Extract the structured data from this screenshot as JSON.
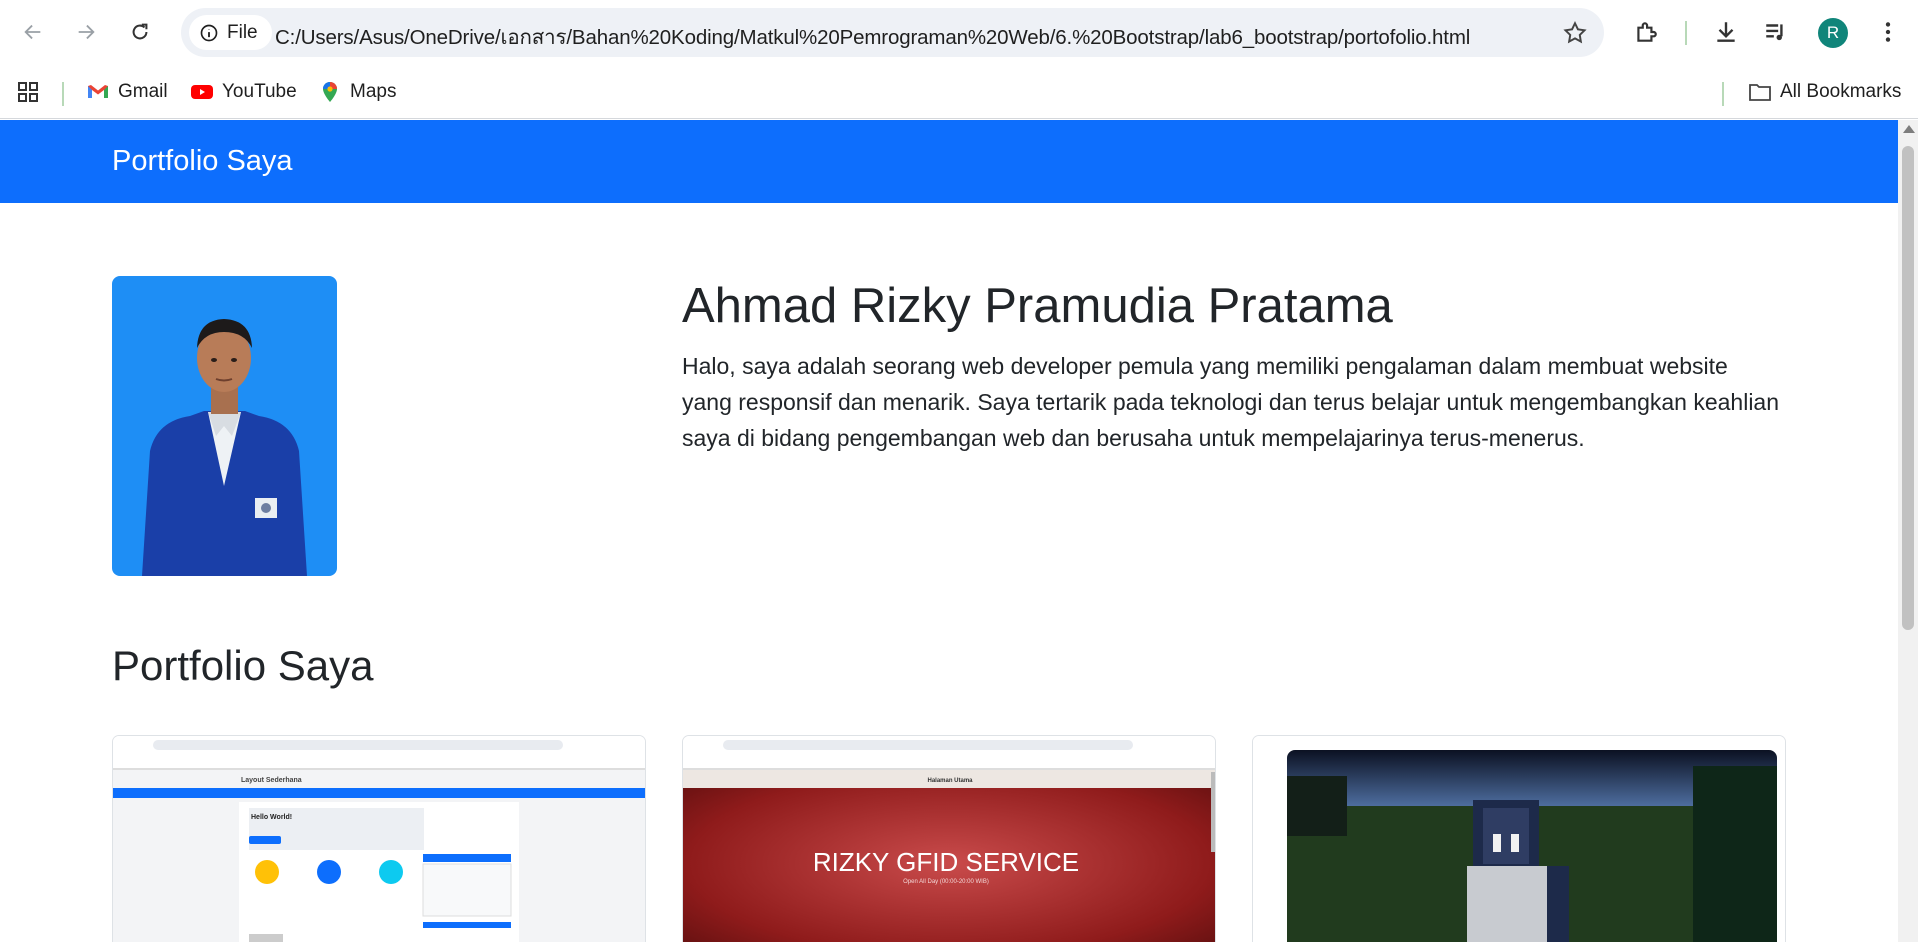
{
  "browser": {
    "chip_label": "File",
    "url": "C:/Users/Asus/OneDrive/เอกสาร/Bahan%20Koding/Matkul%20Pemrograman%20Web/6.%20Bootstrap/lab6_bootstrap/portofolio.html",
    "avatar_letter": "R",
    "bookmarks": [
      "Gmail",
      "YouTube",
      "Maps"
    ],
    "all_bookmarks": "All Bookmarks"
  },
  "page": {
    "brand": "Portfolio Saya",
    "name": "Ahmad Rizky Pramudia Pratama",
    "bio": "Halo, saya adalah seorang web developer pemula yang memiliki pengalaman dalam membuat website yang responsif dan menarik. Saya tertarik pada teknologi dan terus belajar untuk mengembangkan keahlian saya di bidang pengembangan web dan berusaha untuk mempelajarinya terus-menerus.",
    "section_title": "Portfolio Saya",
    "cards": [
      {
        "thumb_title": "Layout Sederhana",
        "thumb_heading": "Hello World!"
      },
      {
        "thumb_header": "Halaman Utama",
        "thumb_title": "RIZKY GFID SERVICE",
        "thumb_sub": "Open All Day (00:00-20:00 WIB)"
      },
      {
        "thumb_kind": "game-screenshot"
      }
    ]
  },
  "colors": {
    "navbar": "#0d6efd",
    "omnibox": "#eef1f6",
    "avatar": "#10857a",
    "photo_bg": "#1e90ff"
  }
}
